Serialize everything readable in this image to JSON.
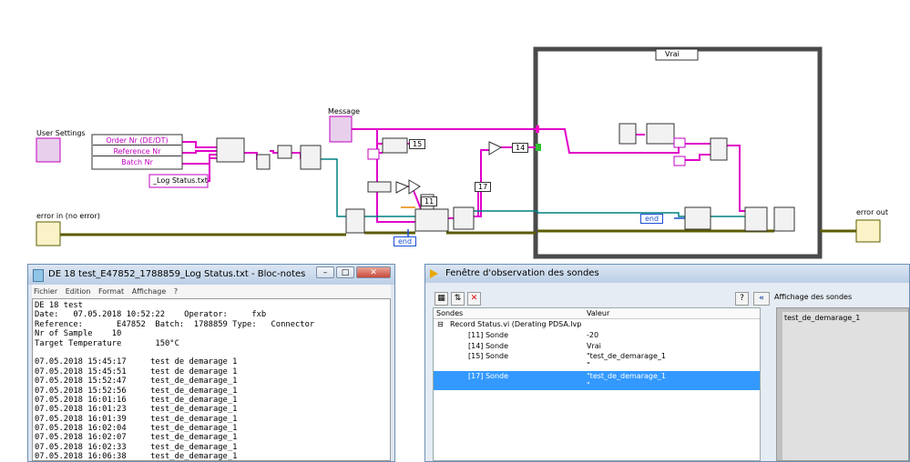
{
  "diagram": {
    "label_user_settings": "User Settings",
    "field_order": "Order Nr (DE/DT)",
    "field_reference": "Reference Nr",
    "field_batch": "Batch Nr",
    "string_constant": "_Log Status.txt",
    "label_message": "Message",
    "label_error_in": "error in (no error)",
    "label_error_out": "error out",
    "case_selector": "Vrai",
    "const_15": "15",
    "const_14": "14",
    "const_11": "11",
    "const_17": "17",
    "enum_end_1": "end",
    "enum_end_2": "end"
  },
  "notepad": {
    "title": "DE 18 test_E47852_1788859_Log Status.txt - Bloc-notes",
    "menu": [
      "Fichier",
      "Edition",
      "Format",
      "Affichage",
      "?"
    ],
    "buttons": {
      "minimize": "–",
      "maximize": "□",
      "close": "✕"
    },
    "lines": [
      "DE 18 test",
      "Date:   07.05.2018 10:52:22    Operator:     fxb",
      "Reference:       E47852  Batch:  1788859 Type:   Connector",
      "Nr of Sample    10",
      "Target Temperature       150°C",
      "",
      "07.05.2018 15:45:17     test de demarage 1",
      "07.05.2018 15:45:51     test de demarage 1",
      "07.05.2018 15:52:47     test_de_demarage_1",
      "07.05.2018 15:52:56     test_de_demarage_1",
      "07.05.2018 16:01:16     test_de_demarage_1",
      "07.05.2018 16:01:23     test_de_demarage_1",
      "07.05.2018 16:01:39     test_de_demarage_1",
      "07.05.2018 16:02:04     test_de_demarage_1",
      "07.05.2018 16:02:07     test_de_demarage_1",
      "07.05.2018 16:02:33     test_de_demarage_1",
      "07.05.2018 16:06:38     test_de_demarage_1"
    ]
  },
  "probe": {
    "title": "Fenêtre d'observation des sondes",
    "col_sondes": "Sondes",
    "col_valeur": "Valeur",
    "affichage_label": "Affichage des sondes",
    "affichage_value": "test_de_demarage_1",
    "rows": [
      {
        "name": "Record Status.vi (Derating PDSA.lvp",
        "value": ""
      },
      {
        "name": "[11] Sonde",
        "value": "-20"
      },
      {
        "name": "[14] Sonde",
        "value": "Vrai"
      },
      {
        "name": "[15] Sonde",
        "value": "\"test_de_demarage_1"
      },
      {
        "name": "",
        "value": "\""
      },
      {
        "name": "[17] Sonde",
        "value": "\"test_de_demarage_1"
      },
      {
        "name": "",
        "value": "\""
      }
    ],
    "colors": {
      "selected": "#3399ff"
    }
  }
}
